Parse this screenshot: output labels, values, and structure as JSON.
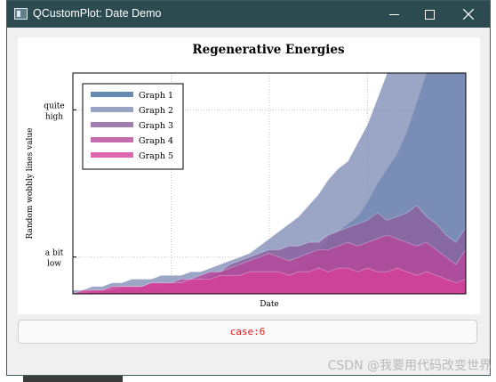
{
  "window": {
    "title": "QCustomPlot: Date Demo"
  },
  "chart_data": {
    "type": "area",
    "title": "Regenerative Energies",
    "xlabel": "Date",
    "ylabel": "Random wobbly lines value",
    "y_ticks": [
      {
        "value": 10,
        "label": "a bit\nlow"
      },
      {
        "value": 50,
        "label": "quite\nhigh"
      }
    ],
    "ylim": [
      0,
      60
    ],
    "grid": true,
    "legend_position": "top-left",
    "x": [
      0,
      1,
      2,
      3,
      4,
      5,
      6,
      7,
      8,
      9,
      10,
      11,
      12,
      13,
      14,
      15,
      16,
      17,
      18,
      19,
      20,
      21,
      22,
      23,
      24,
      25,
      26,
      27,
      28,
      29,
      30,
      31,
      32,
      33,
      34,
      35,
      36,
      37,
      38,
      39,
      40
    ],
    "series": [
      {
        "name": "Graph 1",
        "color": "#3d6d9c",
        "values": [
          0,
          0,
          0,
          1,
          1,
          1,
          1,
          1,
          1,
          1,
          1,
          1,
          2,
          2,
          2,
          2,
          3,
          3,
          3,
          3,
          4,
          5,
          6,
          8,
          10,
          12,
          15,
          17,
          19,
          21,
          25,
          30,
          34,
          38,
          44,
          52,
          60,
          62,
          62,
          62,
          62
        ]
      },
      {
        "name": "Graph 2",
        "color": "#7f8db7",
        "values": [
          1,
          1,
          2,
          2,
          3,
          3,
          4,
          4,
          4,
          5,
          5,
          5,
          6,
          6,
          7,
          8,
          9,
          10,
          11,
          13,
          15,
          17,
          19,
          21,
          24,
          27,
          31,
          34,
          36,
          41,
          46,
          53,
          60,
          64,
          66,
          68,
          68,
          68,
          68,
          68,
          68
        ]
      },
      {
        "name": "Graph 3",
        "color": "#8b5d9e",
        "values": [
          0,
          0,
          0,
          1,
          1,
          1,
          1,
          2,
          2,
          2,
          3,
          3,
          3,
          4,
          5,
          6,
          8,
          9,
          10,
          11,
          12,
          12,
          13,
          13,
          14,
          14,
          16,
          17,
          18,
          19,
          20,
          22,
          20,
          21,
          22,
          24,
          21,
          19,
          16,
          14,
          18
        ]
      },
      {
        "name": "Graph 4",
        "color": "#b6479a",
        "values": [
          0,
          0,
          1,
          1,
          1,
          2,
          2,
          2,
          3,
          3,
          3,
          4,
          4,
          5,
          6,
          6,
          7,
          8,
          9,
          10,
          11,
          10,
          9,
          10,
          11,
          12,
          12,
          13,
          14,
          13,
          14,
          15,
          16,
          15,
          14,
          13,
          14,
          12,
          10,
          8,
          12
        ]
      },
      {
        "name": "Graph 5",
        "color": "#d7409a",
        "values": [
          0,
          1,
          1,
          1,
          2,
          2,
          2,
          2,
          3,
          3,
          3,
          3,
          4,
          4,
          4,
          5,
          5,
          5,
          6,
          6,
          6,
          6,
          5,
          6,
          6,
          7,
          6,
          7,
          7,
          6,
          7,
          6,
          6,
          7,
          6,
          5,
          6,
          5,
          4,
          3,
          4
        ]
      }
    ]
  },
  "case_button": {
    "label": "case:6"
  },
  "watermark": "CSDN @我要用代码改变世界"
}
